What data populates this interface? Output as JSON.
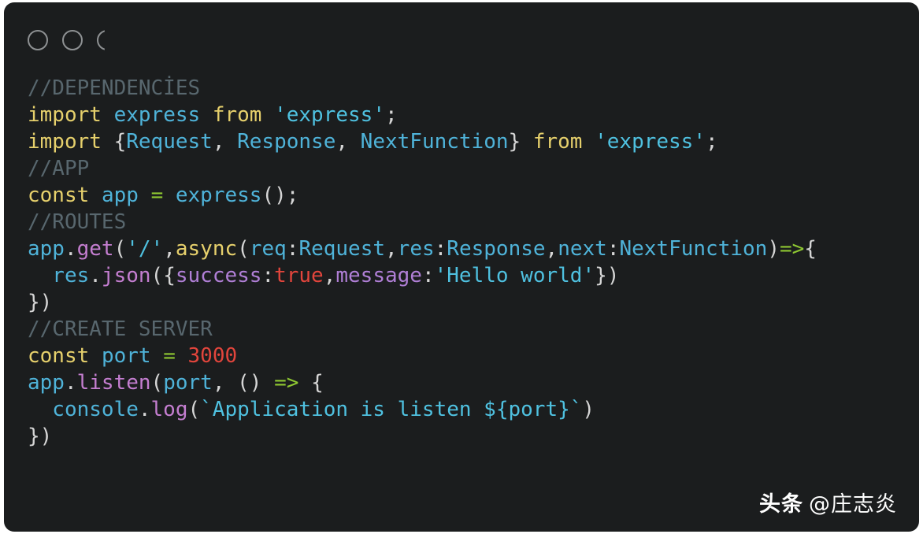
{
  "window": {
    "title": "",
    "controls": [
      {
        "name": "window-dot-1",
        "style": "outline"
      },
      {
        "name": "window-dot-2",
        "style": "outline"
      },
      {
        "name": "window-dot-3",
        "style": "outline-clipped"
      }
    ],
    "background_color": "#1b1d1e",
    "corner_radius_px": 13
  },
  "theme": {
    "comment": "#58676e",
    "keyword": "#e6d06c",
    "identifier": "#4fb3d9",
    "string": "#4fc1e0",
    "punctuation": "#d6d6d6",
    "operator": "#8fc832",
    "method": "#c47ed0",
    "property": "#b07fd6",
    "number": "#e2453c",
    "boolean": "#e2453c"
  },
  "code": {
    "language": "typescript",
    "font_size_px": 26,
    "line_height_px": 34,
    "lines": [
      {
        "id": 1,
        "text": "//DEPENDENCİES",
        "tokens": [
          {
            "t": "//DEPENDENCİES",
            "c": "t-comment"
          }
        ]
      },
      {
        "id": 2,
        "text": "import express from 'express';",
        "tokens": [
          {
            "t": "import",
            "c": "t-keyword"
          },
          {
            "t": " ",
            "c": "t-punct"
          },
          {
            "t": "express",
            "c": "t-ident"
          },
          {
            "t": " ",
            "c": "t-punct"
          },
          {
            "t": "from",
            "c": "t-keyword"
          },
          {
            "t": " ",
            "c": "t-punct"
          },
          {
            "t": "'express'",
            "c": "t-string"
          },
          {
            "t": ";",
            "c": "t-punct"
          }
        ]
      },
      {
        "id": 3,
        "text": "import {Request, Response, NextFunction} from 'express';",
        "tokens": [
          {
            "t": "import",
            "c": "t-keyword"
          },
          {
            "t": " ",
            "c": "t-punct"
          },
          {
            "t": "{",
            "c": "t-punct"
          },
          {
            "t": "Request",
            "c": "t-ident"
          },
          {
            "t": ", ",
            "c": "t-punct"
          },
          {
            "t": "Response",
            "c": "t-ident"
          },
          {
            "t": ", ",
            "c": "t-punct"
          },
          {
            "t": "NextFunction",
            "c": "t-ident"
          },
          {
            "t": "}",
            "c": "t-punct"
          },
          {
            "t": " ",
            "c": "t-punct"
          },
          {
            "t": "from",
            "c": "t-keyword"
          },
          {
            "t": " ",
            "c": "t-punct"
          },
          {
            "t": "'express'",
            "c": "t-string"
          },
          {
            "t": ";",
            "c": "t-punct"
          }
        ]
      },
      {
        "id": 4,
        "text": "//APP",
        "tokens": [
          {
            "t": "//APP",
            "c": "t-comment"
          }
        ]
      },
      {
        "id": 5,
        "text": "const app = express();",
        "tokens": [
          {
            "t": "const",
            "c": "t-keyword"
          },
          {
            "t": " ",
            "c": "t-punct"
          },
          {
            "t": "app",
            "c": "t-ident"
          },
          {
            "t": " ",
            "c": "t-punct"
          },
          {
            "t": "=",
            "c": "t-operator"
          },
          {
            "t": " ",
            "c": "t-punct"
          },
          {
            "t": "express",
            "c": "t-ident"
          },
          {
            "t": "();",
            "c": "t-punct"
          }
        ]
      },
      {
        "id": 6,
        "text": "//ROUTES",
        "tokens": [
          {
            "t": "//ROUTES",
            "c": "t-comment"
          }
        ]
      },
      {
        "id": 7,
        "text": "app.get('/',async(req:Request,res:Response,next:NextFunction)=>{",
        "tokens": [
          {
            "t": "app",
            "c": "t-ident"
          },
          {
            "t": ".",
            "c": "t-punct"
          },
          {
            "t": "get",
            "c": "t-method"
          },
          {
            "t": "(",
            "c": "t-punct"
          },
          {
            "t": "'/'",
            "c": "t-string"
          },
          {
            "t": ",",
            "c": "t-punct"
          },
          {
            "t": "async",
            "c": "t-keyword"
          },
          {
            "t": "(",
            "c": "t-punct"
          },
          {
            "t": "req",
            "c": "t-ident"
          },
          {
            "t": ":",
            "c": "t-punct"
          },
          {
            "t": "Request",
            "c": "t-ident"
          },
          {
            "t": ",",
            "c": "t-punct"
          },
          {
            "t": "res",
            "c": "t-ident"
          },
          {
            "t": ":",
            "c": "t-punct"
          },
          {
            "t": "Response",
            "c": "t-ident"
          },
          {
            "t": ",",
            "c": "t-punct"
          },
          {
            "t": "next",
            "c": "t-ident"
          },
          {
            "t": ":",
            "c": "t-punct"
          },
          {
            "t": "NextFunction",
            "c": "t-ident"
          },
          {
            "t": ")",
            "c": "t-punct"
          },
          {
            "t": "=>",
            "c": "t-operator"
          },
          {
            "t": "{",
            "c": "t-punct"
          }
        ]
      },
      {
        "id": 8,
        "text": "  res.json({success:true,message:'Hello world'})",
        "indent": 2,
        "tokens": [
          {
            "t": "res",
            "c": "t-ident"
          },
          {
            "t": ".",
            "c": "t-punct"
          },
          {
            "t": "json",
            "c": "t-method"
          },
          {
            "t": "({",
            "c": "t-punct"
          },
          {
            "t": "success",
            "c": "t-prop"
          },
          {
            "t": ":",
            "c": "t-punct"
          },
          {
            "t": "true",
            "c": "t-bool"
          },
          {
            "t": ",",
            "c": "t-punct"
          },
          {
            "t": "message",
            "c": "t-prop"
          },
          {
            "t": ":",
            "c": "t-punct"
          },
          {
            "t": "'Hello world'",
            "c": "t-string"
          },
          {
            "t": "})",
            "c": "t-punct"
          }
        ]
      },
      {
        "id": 9,
        "text": "})",
        "tokens": [
          {
            "t": "})",
            "c": "t-punct"
          }
        ]
      },
      {
        "id": 10,
        "text": "//CREATE SERVER",
        "tokens": [
          {
            "t": "//CREATE SERVER",
            "c": "t-comment"
          }
        ]
      },
      {
        "id": 11,
        "text": "const port = 3000",
        "tokens": [
          {
            "t": "const",
            "c": "t-keyword"
          },
          {
            "t": " ",
            "c": "t-punct"
          },
          {
            "t": "port",
            "c": "t-ident"
          },
          {
            "t": " ",
            "c": "t-punct"
          },
          {
            "t": "=",
            "c": "t-operator"
          },
          {
            "t": " ",
            "c": "t-punct"
          },
          {
            "t": "3000",
            "c": "t-number"
          }
        ]
      },
      {
        "id": 12,
        "text": "app.listen(port, () => {",
        "tokens": [
          {
            "t": "app",
            "c": "t-ident"
          },
          {
            "t": ".",
            "c": "t-punct"
          },
          {
            "t": "listen",
            "c": "t-method"
          },
          {
            "t": "(",
            "c": "t-punct"
          },
          {
            "t": "port",
            "c": "t-ident"
          },
          {
            "t": ", () ",
            "c": "t-punct"
          },
          {
            "t": "=>",
            "c": "t-operator"
          },
          {
            "t": " {",
            "c": "t-punct"
          }
        ]
      },
      {
        "id": 13,
        "text": "  console.log(`Application is listen ${port}`)",
        "indent": 2,
        "tokens": [
          {
            "t": "console",
            "c": "t-ident"
          },
          {
            "t": ".",
            "c": "t-punct"
          },
          {
            "t": "log",
            "c": "t-method"
          },
          {
            "t": "(",
            "c": "t-punct"
          },
          {
            "t": "`Application is listen ${port}`",
            "c": "t-string"
          },
          {
            "t": ")",
            "c": "t-punct"
          }
        ]
      },
      {
        "id": 14,
        "text": "})",
        "tokens": [
          {
            "t": "})",
            "c": "t-punct"
          }
        ]
      }
    ]
  },
  "watermark": {
    "brand": "头条",
    "handle": "@庄志炎",
    "color": "#ffffff"
  }
}
